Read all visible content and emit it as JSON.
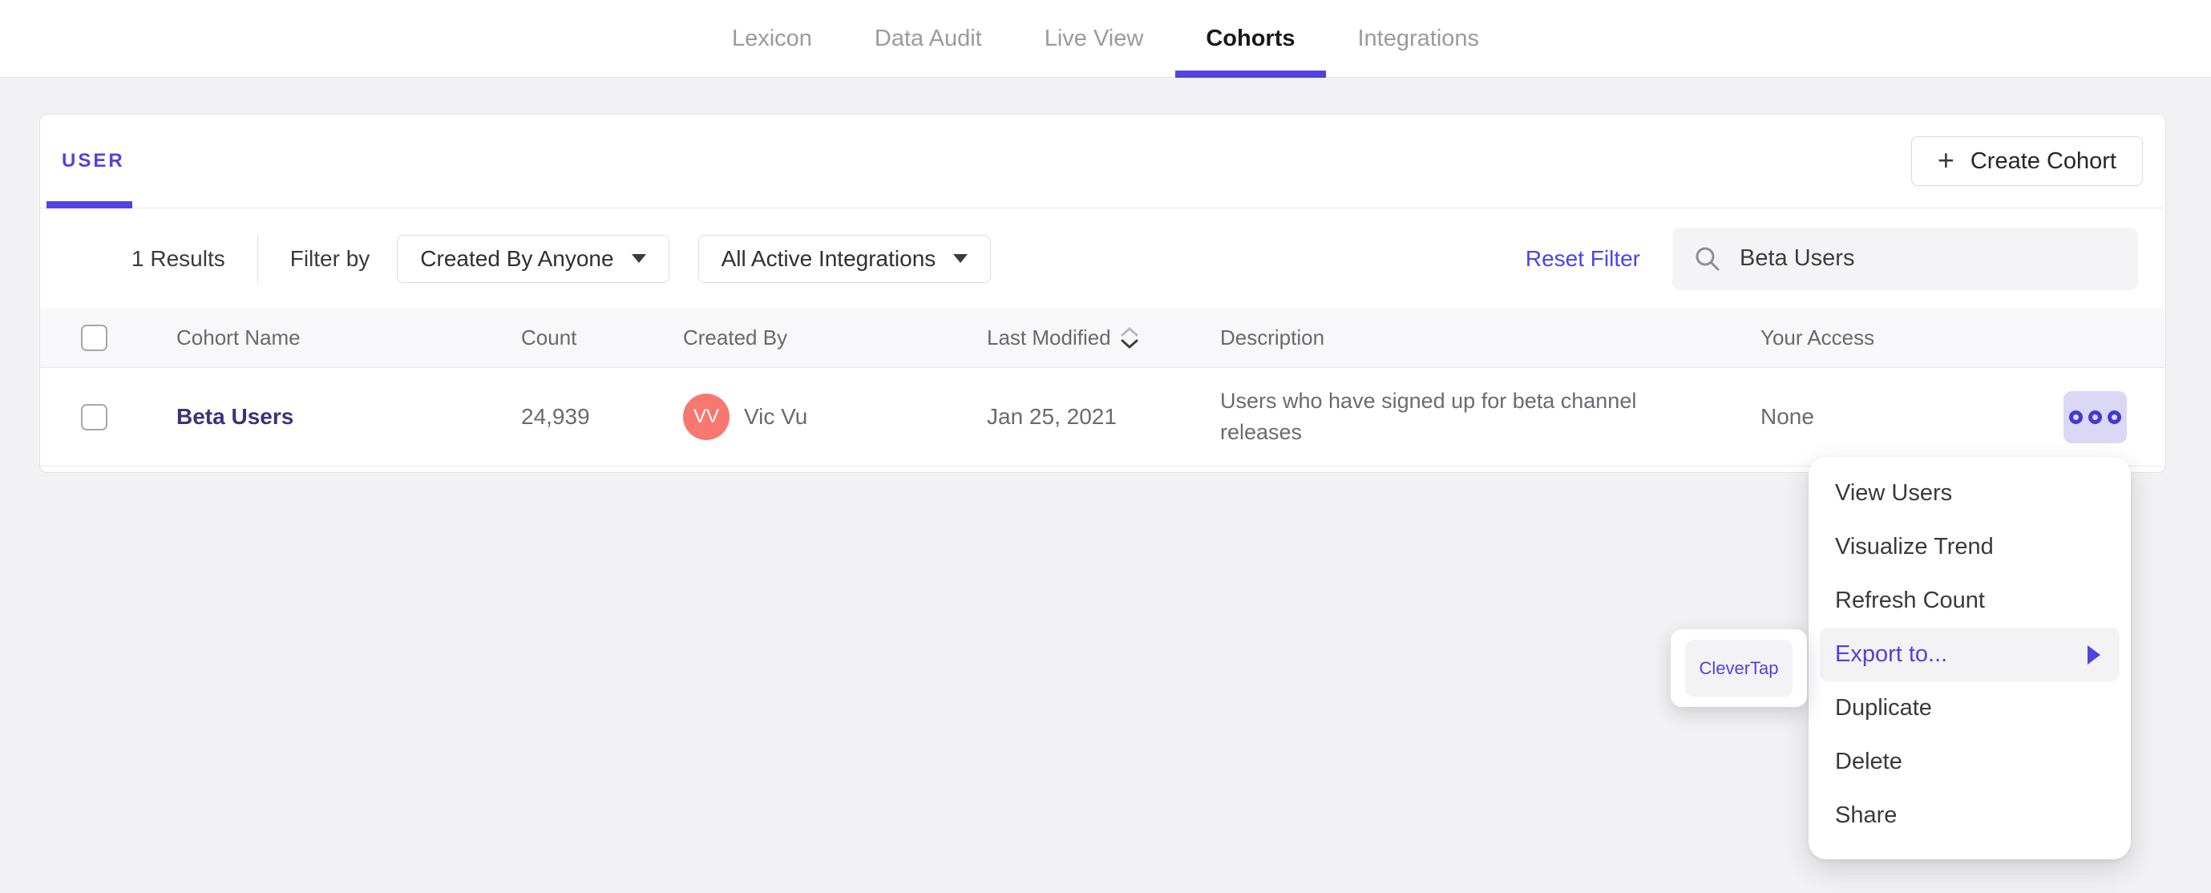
{
  "colors": {
    "accent_purple": "#4F44E0",
    "reset_link_blue": "#4545EF",
    "cohort_link_indigo": "#3A3477",
    "avatar_coral": "#F8786F",
    "more_button_lavender": "#DAD8F5",
    "menu_highlight_gray": "#F3F3F5"
  },
  "topnav": {
    "items": [
      {
        "label": "Lexicon",
        "active": false
      },
      {
        "label": "Data Audit",
        "active": false
      },
      {
        "label": "Live View",
        "active": false
      },
      {
        "label": "Cohorts",
        "active": true
      },
      {
        "label": "Integrations",
        "active": false
      }
    ]
  },
  "card": {
    "tab_label": "USER",
    "create_button": {
      "label": "Create Cohort",
      "icon": "plus-icon"
    },
    "filters": {
      "results_count": "1 Results",
      "filter_by_label": "Filter by",
      "dropdowns": [
        {
          "label": "Created By Anyone",
          "icon": "caret-down-icon"
        },
        {
          "label": "All Active Integrations",
          "icon": "caret-down-icon"
        }
      ],
      "reset_label": "Reset Filter",
      "search": {
        "value": "Beta Users",
        "icon": "search-icon"
      }
    },
    "table": {
      "columns": [
        "Cohort Name",
        "Count",
        "Created By",
        "Last Modified",
        "Description",
        "Your Access"
      ],
      "sort_column": "Last Modified",
      "rows": [
        {
          "name": "Beta Users",
          "count": "24,939",
          "created_by": {
            "initials": "VV",
            "name": "Vic Vu"
          },
          "last_modified": "Jan 25, 2021",
          "description": "Users who have signed up for beta channel releases",
          "your_access": "None"
        }
      ]
    }
  },
  "context_menu": {
    "items": [
      "View Users",
      "Visualize Trend",
      "Refresh Count",
      "Export to...",
      "Duplicate",
      "Delete",
      "Share"
    ],
    "highlighted_item": "Export to..."
  },
  "export_submenu": {
    "items": [
      "CleverTap"
    ]
  }
}
